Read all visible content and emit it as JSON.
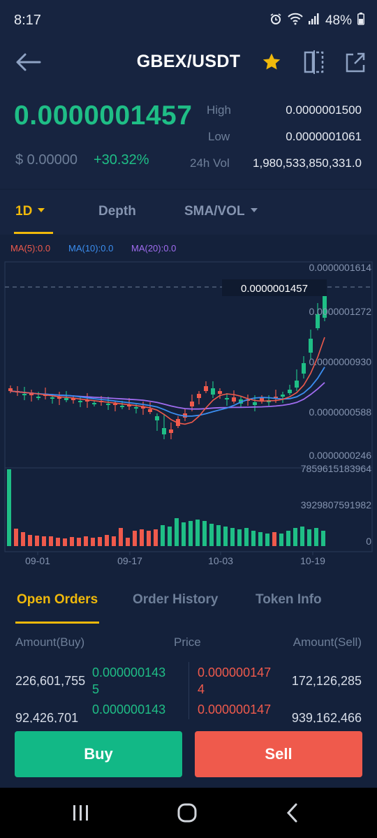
{
  "status_bar": {
    "time": "8:17",
    "battery": "48%"
  },
  "header": {
    "pair": "GBEX/USDT"
  },
  "ticker": {
    "last_price": "0.0000001457",
    "usd_price": "$ 0.00000",
    "change_pct": "+30.32%",
    "high_label": "High",
    "high": "0.0000001500",
    "low_label": "Low",
    "low": "0.0000001061",
    "vol_label": "24h Vol",
    "vol": "1,980,533,850,331.0"
  },
  "chart_tabs": {
    "interval": "1D",
    "depth": "Depth",
    "indicator": "SMA/VOL"
  },
  "ma_legend": {
    "ma5": "MA(5):0.0",
    "ma10": "MA(10):0.0",
    "ma20": "MA(20):0.0"
  },
  "colors": {
    "up": "#1fbe86",
    "down": "#ef5a4c",
    "accent": "#f0b90b",
    "ma5": "#ef5a4c",
    "ma10": "#3b8ef0",
    "ma20": "#a06cf0"
  },
  "chart_data": {
    "type": "candlestick",
    "price_axis_labels": [
      "0.0000001614",
      "0.0000001272",
      "0.0000000930",
      "0.0000000588",
      "0.0000000246"
    ],
    "current_price_label": "0.0000001457",
    "volume_axis_labels": [
      "7859615183964",
      "3929807591982",
      "0"
    ],
    "x_tick_labels": [
      "09-01",
      "09-17",
      "10-03",
      "10-19"
    ]
  },
  "order_tabs": {
    "open_orders": "Open Orders",
    "order_history": "Order History",
    "token_info": "Token Info"
  },
  "orderbook": {
    "head_buy": "Amount(Buy)",
    "head_price": "Price",
    "head_sell": "Amount(Sell)",
    "rows": [
      {
        "buy_amount": "226,601,755",
        "buy_price_l1": "0.000000143",
        "buy_price_l2": "5",
        "sell_price_l1": "0.000000147",
        "sell_price_l2": "4",
        "sell_amount": "172,126,285"
      },
      {
        "buy_amount": "92,426,701",
        "buy_price_l1": "0.000000143",
        "buy_price_l2": "",
        "sell_price_l1": "0.000000147",
        "sell_price_l2": "",
        "sell_amount": "939,162,466"
      }
    ]
  },
  "actions": {
    "buy": "Buy",
    "sell": "Sell"
  }
}
